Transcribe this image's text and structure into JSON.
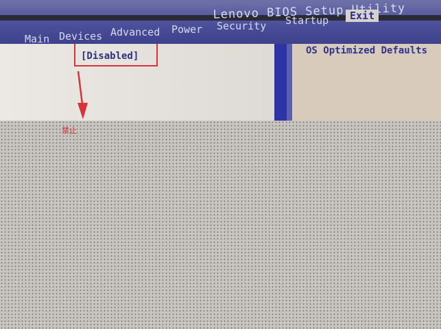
{
  "bios": {
    "title": "Lenovo BIOS Setup Utility",
    "tabs": [
      {
        "label": "Main",
        "active": false
      },
      {
        "label": "Devices",
        "active": false
      },
      {
        "label": "Advanced",
        "active": false
      },
      {
        "label": "Power",
        "active": false
      },
      {
        "label": "Security",
        "active": false
      },
      {
        "label": "Startup",
        "active": false
      },
      {
        "label": "Exit",
        "active": true
      }
    ]
  },
  "content": {
    "option_value": "[Disabled]",
    "annotation_caption": "禁止"
  },
  "help_panel": {
    "text": "OS Optimized Defaults"
  },
  "colors": {
    "menubar": "#4c4f9a",
    "highlight": "#d8323a",
    "option_text": "#2d2f82",
    "help_bg": "#d9cbbc",
    "divider": "#2e33a6"
  }
}
